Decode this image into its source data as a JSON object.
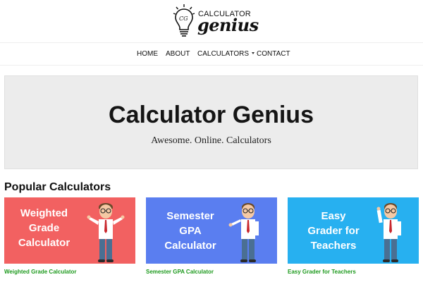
{
  "logo": {
    "line1": "CALCULATOR",
    "line2": "genius",
    "monogram": "CG"
  },
  "nav": {
    "home": "HOME",
    "about": "ABOUT",
    "calculators": "CALCULATORS",
    "contact": "CONTACT"
  },
  "hero": {
    "title": "Calculator Genius",
    "subtitle": "Awesome. Online. Calculators"
  },
  "popular": {
    "heading": "Popular Calculators",
    "cards": [
      {
        "line1": "Weighted",
        "line2": "Grade",
        "line3": "Calculator",
        "link": "Weighted Grade Calculator",
        "color": "#f26161"
      },
      {
        "line1": "Semester",
        "line2": "GPA",
        "line3": "Calculator",
        "link": "Semester GPA Calculator",
        "color": "#5a7ef0"
      },
      {
        "line1": "Easy",
        "line2": "Grader for",
        "line3": "Teachers",
        "link": "Easy Grader for Teachers",
        "color": "#27b0f0"
      }
    ]
  },
  "colors": {
    "link_green": "#1e9a1e",
    "hero_bg": "#ececec"
  },
  "icons": {
    "dropdown": "chevron-down-icon",
    "mascot": "cartoon-professor-illustration",
    "logo_icon": "lightbulb-icon"
  }
}
